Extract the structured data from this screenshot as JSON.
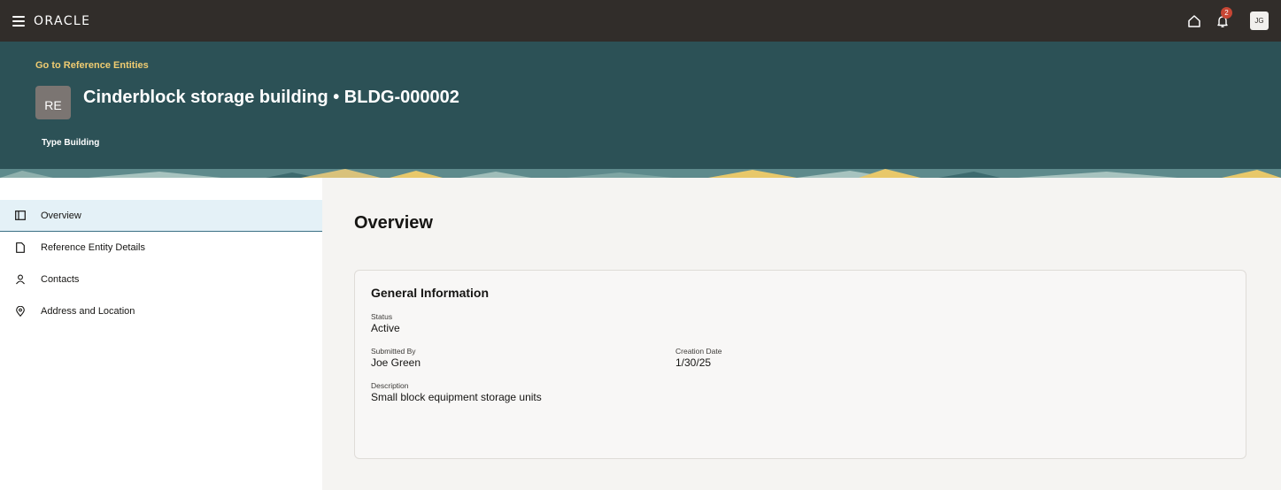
{
  "topbar": {
    "logo": "ORACLE",
    "notification_count": "2",
    "user_initials": "JG"
  },
  "header": {
    "back_link": "Go to Reference Entities",
    "avatar_initials": "RE",
    "title": "Cinderblock storage building • BLDG-000002",
    "type_label": "Type",
    "type_value": "Building"
  },
  "nav": {
    "items": [
      {
        "label": "Overview",
        "icon": "panel-icon"
      },
      {
        "label": "Reference Entity Details",
        "icon": "document-icon"
      },
      {
        "label": "Contacts",
        "icon": "person-icon"
      },
      {
        "label": "Address and Location",
        "icon": "location-pin-icon"
      }
    ]
  },
  "main": {
    "section_title": "Overview",
    "card": {
      "title": "General Information",
      "status_label": "Status",
      "status_value": "Active",
      "submitted_by_label": "Submitted By",
      "submitted_by_value": "Joe Green",
      "creation_date_label": "Creation Date",
      "creation_date_value": "1/30/25",
      "description_label": "Description",
      "description_value": "Small block equipment storage units"
    }
  },
  "colors": {
    "topbar": "#312d2a",
    "header_band": "#2c5156",
    "back_link": "#f0cc71",
    "badge": "#c74634",
    "nav_active_bg": "#e4f1f7",
    "content_bg": "#f5f4f2"
  }
}
